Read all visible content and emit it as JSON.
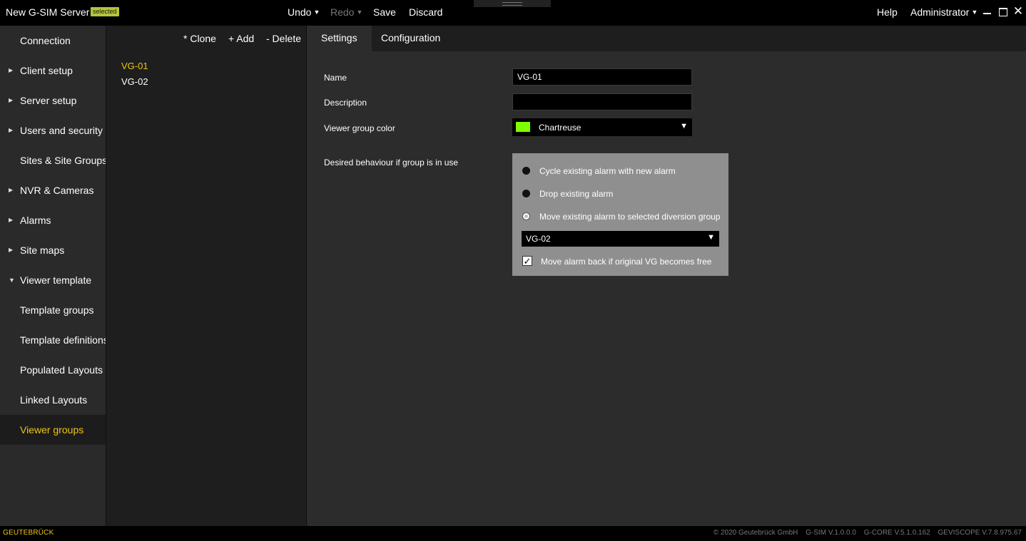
{
  "titlebar": {
    "app_title": "New G-SIM Server",
    "badge": "selected",
    "undo": "Undo",
    "redo": "Redo",
    "save": "Save",
    "discard": "Discard",
    "help": "Help",
    "user": "Administrator"
  },
  "sidebar": {
    "items": [
      {
        "label": "Connection"
      },
      {
        "label": "Client setup"
      },
      {
        "label": "Server setup"
      },
      {
        "label": "Users and security"
      },
      {
        "label": "Sites & Site Groups"
      },
      {
        "label": "NVR & Cameras"
      },
      {
        "label": "Alarms"
      },
      {
        "label": "Site maps"
      },
      {
        "label": "Viewer template"
      },
      {
        "label": "Template groups"
      },
      {
        "label": "Template definitions"
      },
      {
        "label": "Populated Layouts"
      },
      {
        "label": "Linked Layouts"
      },
      {
        "label": "Viewer groups"
      }
    ]
  },
  "list": {
    "clone": "* Clone",
    "add": "+ Add",
    "delete": "- Delete",
    "items": [
      "VG-01",
      "VG-02"
    ]
  },
  "tabs": {
    "settings": "Settings",
    "configuration": "Configuration"
  },
  "form": {
    "name_label": "Name",
    "name_value": "VG-01",
    "description_label": "Description",
    "description_value": "",
    "color_label": "Viewer group color",
    "color_name": "Chartreuse",
    "color_hex": "#7fff00",
    "behaviour_label": "Desired behaviour if group is in use",
    "options": [
      "Cycle existing alarm with new alarm",
      "Drop existing alarm",
      "Move existing alarm to selected diversion group"
    ],
    "diversion_group": "VG-02",
    "move_back_label": "Move  alarm back if original VG becomes free",
    "move_back_checked": true
  },
  "statusbar": {
    "brand": "GEUTEBRÜCK",
    "copyright": "© 2020 Geutebrück GmbH",
    "gsim": "G-SIM V.1.0.0.0",
    "gcore": "G-CORE V.5.1.0.162",
    "geviscope": "GEVISCOPE V.7.8.975.67"
  },
  "colors": {
    "accent": "#f0c419",
    "sidebar_bg": "#2a2a2a",
    "main_bg": "#2c2c2c"
  }
}
